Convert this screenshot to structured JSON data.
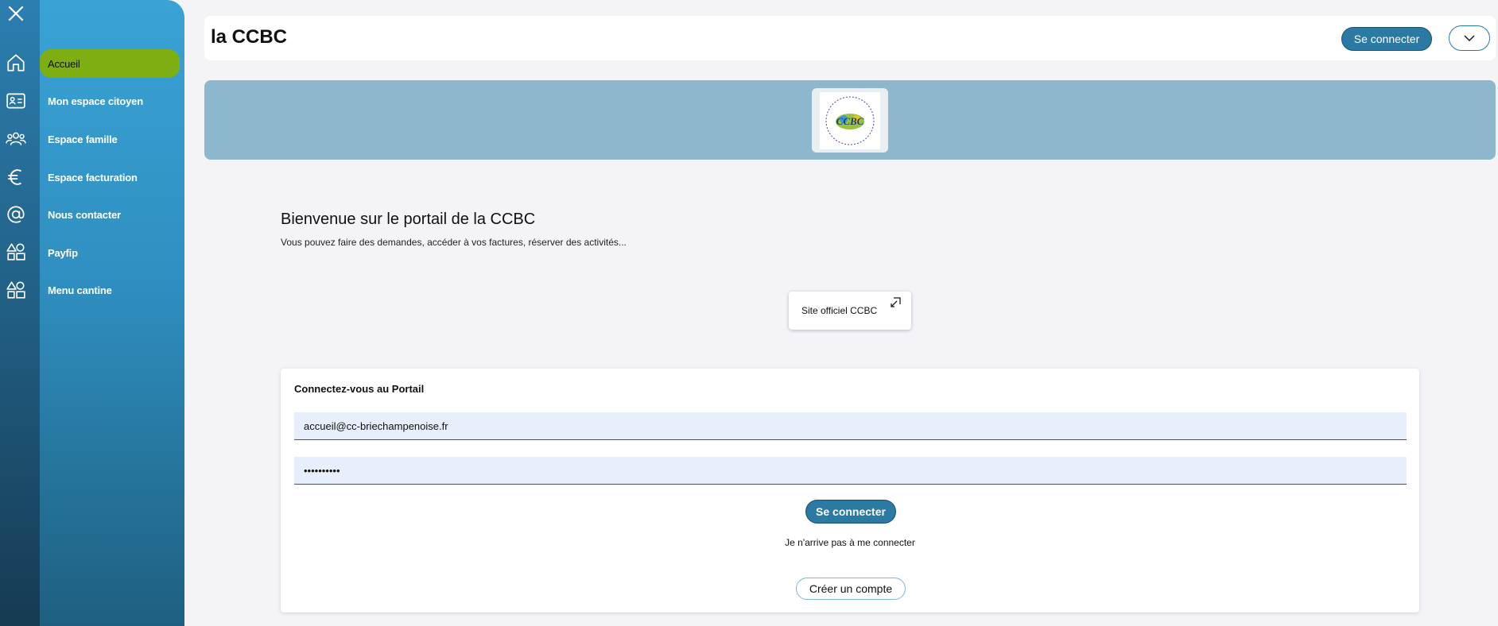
{
  "header": {
    "title": "la CCBC",
    "connect_label": "Se connecter"
  },
  "sidebar": {
    "items": [
      {
        "label": "Accueil",
        "icon": "home-icon"
      },
      {
        "label": "Mon espace citoyen",
        "icon": "id-card-icon"
      },
      {
        "label": "Espace famille",
        "icon": "family-icon"
      },
      {
        "label": "Espace facturation",
        "icon": "euro-icon"
      },
      {
        "label": "Nous contacter",
        "icon": "at-icon"
      },
      {
        "label": "Payfip",
        "icon": "shapes-icon"
      },
      {
        "label": "Menu cantine",
        "icon": "shapes-icon"
      }
    ]
  },
  "banner": {
    "logo": "CCBC"
  },
  "welcome": {
    "title": "Bienvenue sur le portail de la CCBC",
    "subtitle": "Vous pouvez faire des demandes, accéder à vos factures, réserver des activités..."
  },
  "site_link": {
    "label": "Site officiel CCBC"
  },
  "login": {
    "title": "Connectez-vous au Portail",
    "email_value": "accueil@cc-briechampenoise.fr",
    "password_value": "••••••••••",
    "submit_label": "Se connecter",
    "forgot_label": "Je n'arrive pas à me connecter",
    "create_label": "Créer un compte"
  },
  "colors": {
    "primary": "#2a7aa3",
    "active_menu": "#7fae12",
    "banner": "#8db7cd"
  }
}
